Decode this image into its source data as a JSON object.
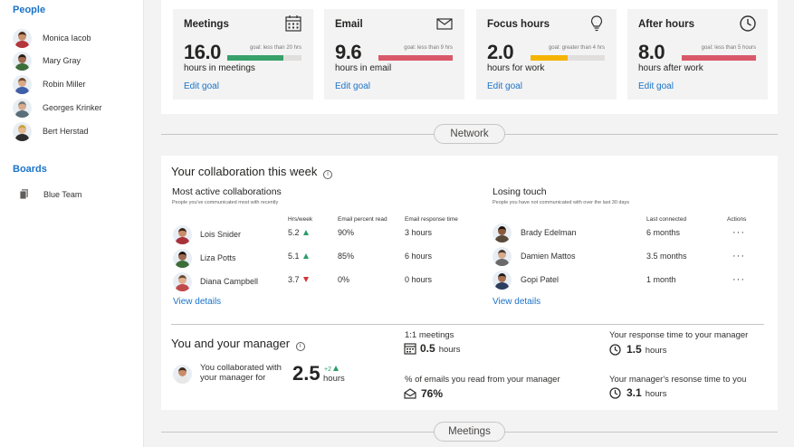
{
  "sidebar": {
    "people_heading": "People",
    "people": [
      {
        "name": "Monica Iacob",
        "skin": "#c9906e",
        "hair": "#4a2a1a",
        "shirt": "#b3373c"
      },
      {
        "name": "Mary Gray",
        "skin": "#a06a4e",
        "hair": "#2a1a12",
        "shirt": "#3c6e3a"
      },
      {
        "name": "Robin Miller",
        "skin": "#d9a98a",
        "hair": "#6e4a2a",
        "shirt": "#3f5fa8"
      },
      {
        "name": "Georges Krinker",
        "skin": "#d6ab8e",
        "hair": "#7a7a7a",
        "shirt": "#5a6f7a"
      },
      {
        "name": "Bert Herstad",
        "skin": "#e3b98f",
        "hair": "#c9a33f",
        "shirt": "#2e2e2e"
      }
    ],
    "boards_heading": "Boards",
    "boards": [
      {
        "name": "Blue Team",
        "icon": "board-stack-icon"
      }
    ]
  },
  "cards": [
    {
      "title": "Meetings",
      "icon": "calendar-icon",
      "value": "16.0",
      "goal": "goal: less than 20 hrs",
      "fill": 0.76,
      "bar_color": "#38a169",
      "subtitle": "hours in meetings",
      "link": "Edit goal"
    },
    {
      "title": "Email",
      "icon": "envelope-icon",
      "value": "9.6",
      "goal": "goal: less than 9 hrs",
      "fill": 1.0,
      "bar_color": "#d9596a",
      "subtitle": "hours in email",
      "link": "Edit goal"
    },
    {
      "title": "Focus hours",
      "icon": "lightbulb-icon",
      "value": "2.0",
      "goal": "goal: greater than 4 hrs",
      "fill": 0.5,
      "bar_color": "#f4b400",
      "subtitle": "hours for work",
      "link": "Edit goal"
    },
    {
      "title": "After hours",
      "icon": "clock-icon",
      "value": "8.0",
      "goal": "goal: less than 5 hours",
      "fill": 1.0,
      "bar_color": "#d9596a",
      "subtitle": "hours after work",
      "link": "Edit goal"
    }
  ],
  "sections": {
    "network": "Network",
    "meetings": "Meetings"
  },
  "collaboration": {
    "title": "Your collaboration this week",
    "active": {
      "heading": "Most active collaborations",
      "subheading": "People you've communicated most with recently",
      "columns": [
        "Hrs/week",
        "Email percent read",
        "Email response time"
      ],
      "rows": [
        {
          "name": "Lois Snider",
          "hrs": "5.2",
          "trend": "up",
          "read": "90%",
          "resp": "3 hours",
          "skin": "#c98c6a",
          "hair": "#3a2418",
          "shirt": "#a8323a"
        },
        {
          "name": "Liza Potts",
          "hrs": "5.1",
          "trend": "up",
          "read": "85%",
          "resp": "6 hours",
          "skin": "#9a6a4e",
          "hair": "#1e120c",
          "shirt": "#3c6e3a"
        },
        {
          "name": "Diana Campbell",
          "hrs": "3.7",
          "trend": "down",
          "read": "0%",
          "resp": "0 hours",
          "skin": "#e0b090",
          "hair": "#6a4a2a",
          "shirt": "#c04a4a"
        }
      ],
      "link": "View details"
    },
    "losing": {
      "heading": "Losing touch",
      "subheading": "People you have not communicated with over the last 30 days",
      "columns": [
        "Last connected",
        "Actions"
      ],
      "rows": [
        {
          "name": "Brady Edelman",
          "last": "6 months",
          "skin": "#8a5a3e",
          "hair": "#1e120c",
          "shirt": "#5a4a3a"
        },
        {
          "name": "Damien Mattos",
          "last": "3.5 months",
          "skin": "#d6ab8e",
          "hair": "#4a3a2a",
          "shirt": "#6a6a6a"
        },
        {
          "name": "Gopi Patel",
          "last": "1 month",
          "skin": "#a87050",
          "hair": "#1a1a1a",
          "shirt": "#2e3e5e"
        }
      ],
      "actions": "···",
      "link": "View details"
    }
  },
  "manager": {
    "title": "You and your manager",
    "collab_text": "You collaborated with your manager for",
    "collab_value": "2.5",
    "collab_delta": "+2",
    "collab_unit": "hours",
    "meetings_label": "1:1 meetings",
    "meetings_value": "0.5",
    "meetings_unit": "hours",
    "emails_label": "% of emails you read from your manager",
    "emails_value": "76%",
    "response_label": "Your response time to your manager",
    "response_value": "1.5",
    "response_unit": "hours",
    "mgr_response_label": "Your manager's resonse time to you",
    "mgr_response_value": "3.1",
    "mgr_response_unit": "hours"
  }
}
